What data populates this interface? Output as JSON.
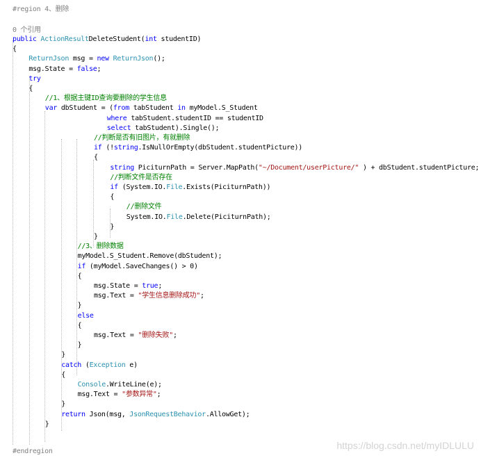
{
  "code": {
    "region_start": "#region 4、删除",
    "ref_count": "0 个引用",
    "lines": [
      {
        "indent": 0,
        "segs": [
          [
            "kw",
            "public "
          ],
          [
            "ty",
            "ActionResult"
          ],
          [
            "",
            "DeleteStudent("
          ],
          [
            "kw",
            "int"
          ],
          [
            "",
            " studentID)"
          ]
        ]
      },
      {
        "indent": 0,
        "segs": [
          [
            "",
            "{"
          ]
        ]
      },
      {
        "indent": 1,
        "segs": [
          [
            "ty",
            "ReturnJson"
          ],
          [
            "",
            " msg = "
          ],
          [
            "kw",
            "new "
          ],
          [
            "ty",
            "ReturnJson"
          ],
          [
            "",
            "();"
          ]
        ]
      },
      {
        "indent": 1,
        "segs": [
          [
            "",
            "msg.State = "
          ],
          [
            "kw",
            "false"
          ],
          [
            "",
            ";"
          ]
        ]
      },
      {
        "indent": 1,
        "segs": [
          [
            "kw",
            "try"
          ]
        ]
      },
      {
        "indent": 1,
        "segs": [
          [
            "",
            "{"
          ]
        ]
      },
      {
        "indent": 2,
        "segs": [
          [
            "cm",
            "//1、根据主键ID查询要删除的学生信息"
          ]
        ]
      },
      {
        "indent": 2,
        "segs": [
          [
            "kw",
            "var"
          ],
          [
            "",
            " dbStudent = ("
          ],
          [
            "kw",
            "from"
          ],
          [
            "",
            " tabStudent "
          ],
          [
            "kw",
            "in"
          ],
          [
            "",
            " myModel.S_Student"
          ]
        ]
      },
      {
        "indent": 5.8,
        "segs": [
          [
            "kw",
            "where"
          ],
          [
            "",
            " tabStudent.studentID == studentID"
          ]
        ]
      },
      {
        "indent": 5.8,
        "segs": [
          [
            "kw",
            "select"
          ],
          [
            "",
            " tabStudent).Single();"
          ]
        ]
      },
      {
        "indent": 5,
        "segs": [
          [
            "cm",
            "//判断是否有旧图片，有就删除"
          ]
        ]
      },
      {
        "indent": 5,
        "segs": [
          [
            "kw",
            "if"
          ],
          [
            "",
            " (!"
          ],
          [
            "kw",
            "string"
          ],
          [
            "",
            ".IsNullOrEmpty(dbStudent.studentPicture))"
          ]
        ]
      },
      {
        "indent": 5,
        "segs": [
          [
            "",
            "{"
          ]
        ]
      },
      {
        "indent": 6,
        "segs": [
          [
            "kw",
            "string"
          ],
          [
            "",
            " PiciturnPath = Server.MapPath("
          ],
          [
            "st",
            "\"~/Document/userPicture/\""
          ],
          [
            "",
            " ) + dbStudent.studentPicture;"
          ]
        ]
      },
      {
        "indent": 6,
        "segs": [
          [
            "cm",
            "//判断文件是否存在"
          ]
        ]
      },
      {
        "indent": 6,
        "segs": [
          [
            "kw",
            "if"
          ],
          [
            "",
            " (System.IO."
          ],
          [
            "ty",
            "File"
          ],
          [
            "",
            ".Exists(PiciturnPath))"
          ]
        ]
      },
      {
        "indent": 6,
        "segs": [
          [
            "",
            "{"
          ]
        ]
      },
      {
        "indent": 7,
        "segs": [
          [
            "cm",
            "//删除文件"
          ]
        ]
      },
      {
        "indent": 7,
        "segs": [
          [
            "",
            "System.IO."
          ],
          [
            "ty",
            "File"
          ],
          [
            "",
            ".Delete(PiciturnPath);"
          ]
        ]
      },
      {
        "indent": 6,
        "segs": [
          [
            "",
            "}"
          ]
        ]
      },
      {
        "indent": 5,
        "segs": [
          [
            "",
            "}"
          ]
        ]
      },
      {
        "indent": 4,
        "segs": [
          [
            "cm",
            "//3、删除数据"
          ]
        ]
      },
      {
        "indent": 4,
        "segs": [
          [
            "",
            "myModel.S_Student.Remove(dbStudent);"
          ]
        ]
      },
      {
        "indent": 4,
        "segs": [
          [
            "kw",
            "if"
          ],
          [
            "",
            " (myModel.SaveChanges() > 0)"
          ]
        ]
      },
      {
        "indent": 4,
        "segs": [
          [
            "",
            "{"
          ]
        ]
      },
      {
        "indent": 5,
        "segs": [
          [
            "",
            "msg.State = "
          ],
          [
            "kw",
            "true"
          ],
          [
            "",
            ";"
          ]
        ]
      },
      {
        "indent": 5,
        "segs": [
          [
            "",
            "msg.Text = "
          ],
          [
            "st",
            "\"学生信息删除成功\""
          ],
          [
            "",
            ";"
          ]
        ]
      },
      {
        "indent": 4,
        "segs": [
          [
            "",
            "}"
          ]
        ]
      },
      {
        "indent": 4,
        "segs": [
          [
            "kw",
            "else"
          ]
        ]
      },
      {
        "indent": 4,
        "segs": [
          [
            "",
            "{"
          ]
        ]
      },
      {
        "indent": 5,
        "segs": [
          [
            "",
            "msg.Text = "
          ],
          [
            "st",
            "\"删除失败\""
          ],
          [
            "",
            ";"
          ]
        ]
      },
      {
        "indent": 4,
        "segs": [
          [
            "",
            "}"
          ]
        ]
      },
      {
        "indent": 3,
        "segs": [
          [
            "",
            "}"
          ]
        ]
      },
      {
        "indent": 3,
        "segs": [
          [
            "kw",
            "catch"
          ],
          [
            "",
            " ("
          ],
          [
            "ty",
            "Exception"
          ],
          [
            "",
            " e)"
          ]
        ]
      },
      {
        "indent": 3,
        "segs": [
          [
            "",
            "{"
          ]
        ]
      },
      {
        "indent": 4,
        "segs": [
          [
            "ty",
            "Console"
          ],
          [
            "",
            ".WriteLine(e);"
          ]
        ]
      },
      {
        "indent": 4,
        "segs": [
          [
            "",
            "msg.Text = "
          ],
          [
            "st",
            "\"参数异常\""
          ],
          [
            "",
            ";"
          ]
        ]
      },
      {
        "indent": 3,
        "segs": [
          [
            "",
            "}"
          ]
        ]
      },
      {
        "indent": 3,
        "segs": [
          [
            "kw",
            "return"
          ],
          [
            "",
            " Json(msg, "
          ],
          [
            "ty",
            "JsonRequestBehavior"
          ],
          [
            "",
            ".AllowGet);"
          ]
        ]
      },
      {
        "indent": 2,
        "segs": [
          [
            "",
            "}"
          ]
        ]
      }
    ],
    "region_end": "#endregion"
  },
  "watermark": "https://blog.csdn.net/myIDLULU",
  "colors": {
    "keyword": "#0000ff",
    "type": "#2b91af",
    "string": "#a31515",
    "comment": "#008000",
    "text": "#000000",
    "region": "#808080",
    "watermark": "#d3d3d3"
  }
}
